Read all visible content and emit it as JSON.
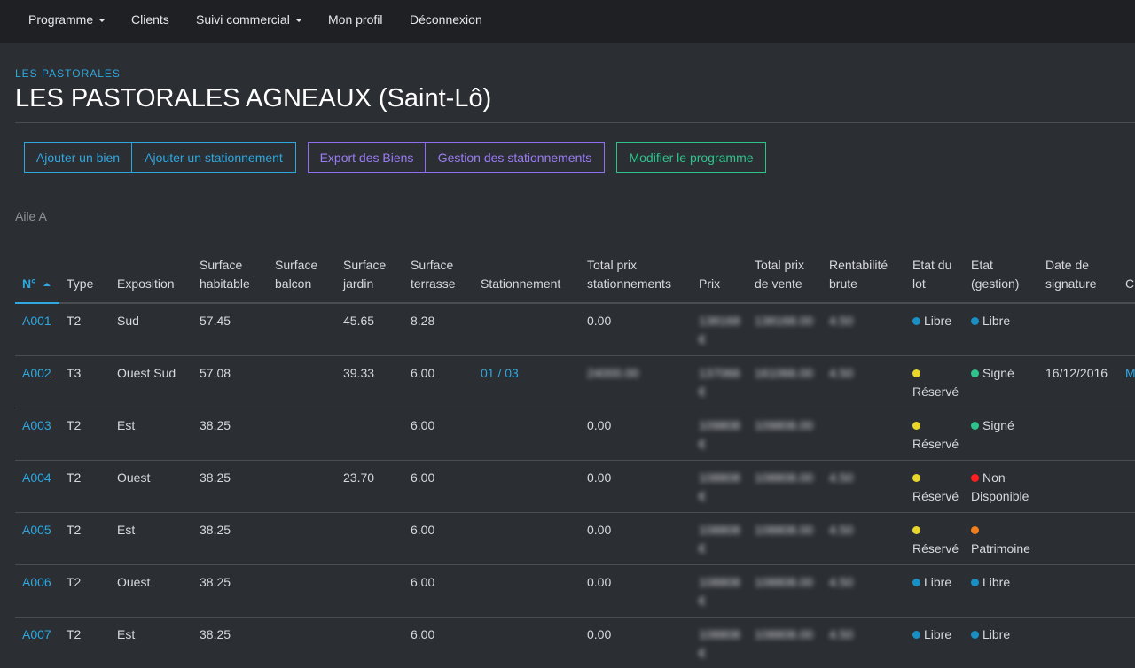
{
  "nav": {
    "programme": "Programme",
    "clients": "Clients",
    "suivi": "Suivi commercial",
    "profil": "Mon profil",
    "deconnexion": "Déconnexion"
  },
  "header": {
    "eyebrow": "LES PASTORALES",
    "title": "LES PASTORALES AGNEAUX (Saint-Lô)"
  },
  "buttons": {
    "add_bien": "Ajouter un bien",
    "add_stationnement": "Ajouter un stationnement",
    "export": "Export des Biens",
    "gestion": "Gestion des stationnements",
    "modifier": "Modifier le programme"
  },
  "group_label": "Aile A",
  "colors": {
    "accent": "#2ea8df",
    "purple": "#9b7cf5",
    "green": "#2ec38b",
    "status_libre": "#1a8fc4",
    "status_reserve": "#e8d62a",
    "status_signe": "#2ec38b",
    "status_nondispo": "#ff1f1f",
    "status_patrimoine": "#f07f1c"
  },
  "table": {
    "headers": {
      "num": "N°",
      "type": "Type",
      "exposition": "Exposition",
      "surf_hab": "Surface habitable",
      "surf_bal": "Surface balcon",
      "surf_jar": "Surface jardin",
      "surf_ter": "Surface terrasse",
      "stationnement": "Stationnement",
      "total_station": "Total prix stationnements",
      "prix": "Prix",
      "total_vente": "Total prix de vente",
      "rentabilite": "Rentabilité brute",
      "etat_lot": "Etat du lot",
      "etat_gestion": "Etat (gestion)",
      "date_sign": "Date de signature",
      "client": "Cl"
    },
    "rows": [
      {
        "num": "A001",
        "type": "T2",
        "expo": "Sud",
        "hab": "57.45",
        "bal": "",
        "jar": "45.65",
        "ter": "8.28",
        "park": "",
        "total_park": "0.00",
        "prix": "138168 €",
        "vente": "138168.00",
        "rent": "4.50",
        "lot": "Libre",
        "gestion": "Libre",
        "date": "",
        "client": ""
      },
      {
        "num": "A002",
        "type": "T3",
        "expo": "Ouest Sud",
        "hab": "57.08",
        "bal": "",
        "jar": "39.33",
        "ter": "6.00",
        "park": "01 / 03",
        "total_park": "24000.00",
        "prix": "137066 €",
        "vente": "161066.00",
        "rent": "4.50",
        "lot": "Réservé",
        "gestion": "Signé",
        "date": "16/12/2016",
        "client": "M Té"
      },
      {
        "num": "A003",
        "type": "T2",
        "expo": "Est",
        "hab": "38.25",
        "bal": "",
        "jar": "",
        "ter": "6.00",
        "park": "",
        "total_park": "0.00",
        "prix": "109808 €",
        "vente": "109808.00",
        "rent": "",
        "lot": "Réservé",
        "gestion": "Signé",
        "date": "",
        "client": ""
      },
      {
        "num": "A004",
        "type": "T2",
        "expo": "Ouest",
        "hab": "38.25",
        "bal": "",
        "jar": "23.70",
        "ter": "6.00",
        "park": "",
        "total_park": "0.00",
        "prix": "108808 €",
        "vente": "108808.00",
        "rent": "4.50",
        "lot": "Réservé",
        "gestion": "Non Disponible",
        "date": "",
        "client": ""
      },
      {
        "num": "A005",
        "type": "T2",
        "expo": "Est",
        "hab": "38.25",
        "bal": "",
        "jar": "",
        "ter": "6.00",
        "park": "",
        "total_park": "0.00",
        "prix": "108808 €",
        "vente": "108808.00",
        "rent": "4.50",
        "lot": "Réservé",
        "gestion": "Patrimoine",
        "date": "",
        "client": ""
      },
      {
        "num": "A006",
        "type": "T2",
        "expo": "Ouest",
        "hab": "38.25",
        "bal": "",
        "jar": "",
        "ter": "6.00",
        "park": "",
        "total_park": "0.00",
        "prix": "108808 €",
        "vente": "108808.00",
        "rent": "4.50",
        "lot": "Libre",
        "gestion": "Libre",
        "date": "",
        "client": ""
      },
      {
        "num": "A007",
        "type": "T2",
        "expo": "Est",
        "hab": "38.25",
        "bal": "",
        "jar": "",
        "ter": "6.00",
        "park": "",
        "total_park": "0.00",
        "prix": "108808 €",
        "vente": "108808.00",
        "rent": "4.50",
        "lot": "Libre",
        "gestion": "Libre",
        "date": "",
        "client": ""
      }
    ]
  }
}
